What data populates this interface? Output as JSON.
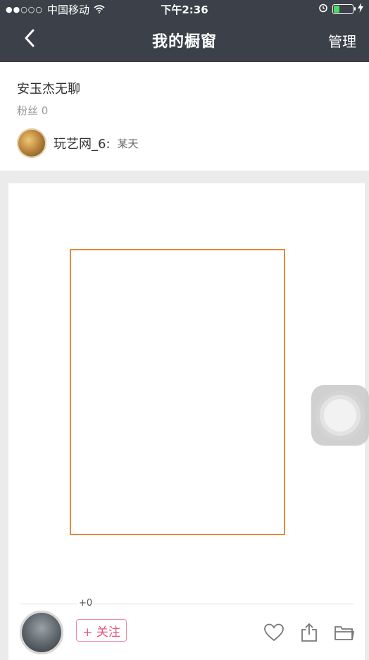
{
  "status": {
    "carrier": "中国移动",
    "time": "下午2:36"
  },
  "nav": {
    "title": "我的橱窗",
    "manage_label": "管理"
  },
  "profile": {
    "name": "安玉杰无聊",
    "fans_text": "粉丝 0",
    "user_label": "玩艺网_6:",
    "time_label": "某天"
  },
  "card": {
    "plus_count": "+0",
    "follow_label": "+ 关注"
  },
  "colors": {
    "nav_bg": "#3c4048",
    "accent_pink": "#e9537a",
    "placeholder_border": "#e8883a",
    "battery_green": "#4cd964"
  },
  "icons": {
    "back": "chevron-left-icon",
    "wifi": "wifi-icon",
    "alarm": "alarm-icon",
    "charging": "bolt-icon",
    "like": "heart-icon",
    "share": "share-icon",
    "collect": "folder-icon"
  }
}
